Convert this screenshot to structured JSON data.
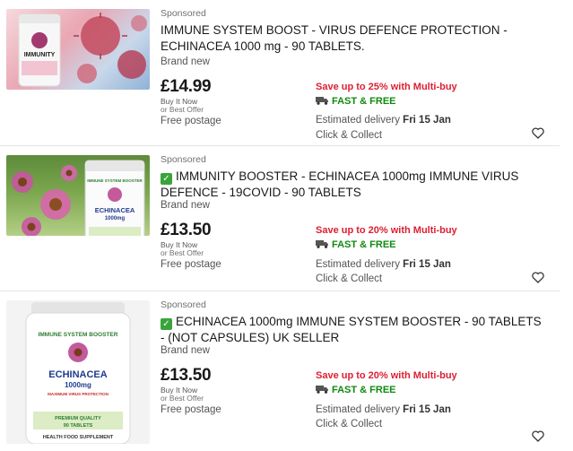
{
  "listings": [
    {
      "sponsored": "Sponsored",
      "title": "IMMUNE SYSTEM BOOST - VIRUS DEFENCE PROTECTION - ECHINACEA 1000 mg - 90 TABLETS.",
      "condition": "Brand new",
      "price": "£14.99",
      "buy_format": "Buy It Now",
      "best_offer": "or Best Offer",
      "postage": "Free postage",
      "multibuy": "Save up to 25% with Multi-buy",
      "fast_free": "FAST & FREE",
      "delivery_label": "Estimated delivery",
      "delivery_date": "Fri 15 Jan",
      "collect": "Click & Collect",
      "image_label": "IMMUNITY"
    },
    {
      "sponsored": "Sponsored",
      "title": "IMMUNITY BOOSTER - ECHINACEA 1000mg IMMUNE VIRUS DEFENCE - 19COVID - 90 TABLETS",
      "condition": "Brand new",
      "price": "£13.50",
      "buy_format": "Buy It Now",
      "best_offer": "or Best Offer",
      "postage": "Free postage",
      "multibuy": "Save up to 20% with Multi-buy",
      "fast_free": "FAST & FREE",
      "delivery_label": "Estimated delivery",
      "delivery_date": "Fri 15 Jan",
      "collect": "Click & Collect",
      "image_label": "ECHINACEA",
      "image_sub": "1000mg",
      "image_brand": "IMMUNE SYSTEM BOOSTER"
    },
    {
      "sponsored": "Sponsored",
      "title": "ECHINACEA 1000mg IMMUNE SYSTEM BOOSTER - 90 TABLETS - (NOT CAPSULES) UK SELLER",
      "condition": "Brand new",
      "price": "£13.50",
      "buy_format": "Buy It Now",
      "best_offer": "or Best Offer",
      "postage": "Free postage",
      "multibuy": "Save up to 20% with Multi-buy",
      "fast_free": "FAST & FREE",
      "delivery_label": "Estimated delivery",
      "delivery_date": "Fri 15 Jan",
      "collect": "Click & Collect",
      "image_brand": "IMMUNE SYSTEM BOOSTER",
      "image_label": "ECHINACEA",
      "image_sub": "1000mg",
      "image_claim": "MAXIMUM VIRUS PROTECTION",
      "image_quality": "PREMIUM QUALITY",
      "image_count": "90 TABLETS",
      "image_footer": "HEALTH FOOD SUPPLEMENT"
    }
  ],
  "colors": {
    "multibuy": "#dd1e31",
    "fast_free": "#0f8a0f",
    "check": "#3aa43a"
  }
}
